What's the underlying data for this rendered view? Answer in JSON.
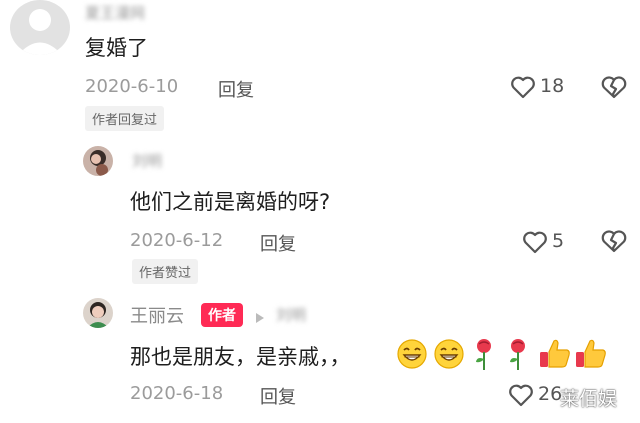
{
  "comments": [
    {
      "username": "夏王漫网",
      "text": "复婚了",
      "date": "2020-6-10",
      "reply_label": "回复",
      "likes": "18",
      "tag": "作者回复过"
    },
    {
      "username": "刘明",
      "text": "他们之前是离婚的呀?",
      "date": "2020-6-12",
      "reply_label": "回复",
      "likes": "5",
      "tag": "作者赞过"
    },
    {
      "username": "王丽云",
      "author_badge": "作者",
      "reply_to": "刘明",
      "text": "那也是朋友，是亲戚，，",
      "date": "2020-6-18",
      "reply_label": "回复",
      "likes": "26"
    }
  ],
  "watermark": "莱佰娱",
  "icons": [
    "heart-icon",
    "broken-heart-icon",
    "play-arrow-icon",
    "grin-emoji",
    "rose-emoji",
    "thumbs-up-emoji"
  ]
}
